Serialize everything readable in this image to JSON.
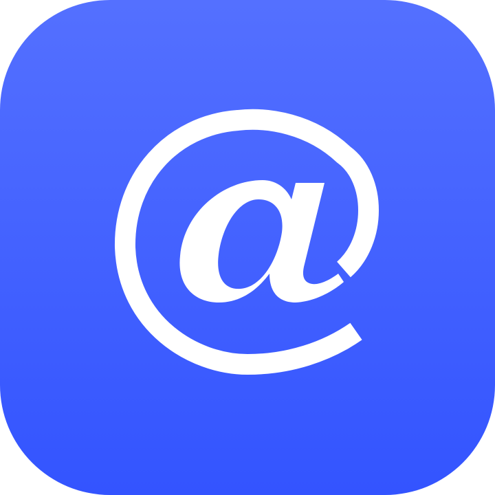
{
  "app_icon": {
    "icon_name": "at-sign-icon",
    "symbol": "@",
    "colors": {
      "background_top": "#5470ff",
      "background_bottom": "#3354ff",
      "glyph": "#ffffff"
    }
  }
}
